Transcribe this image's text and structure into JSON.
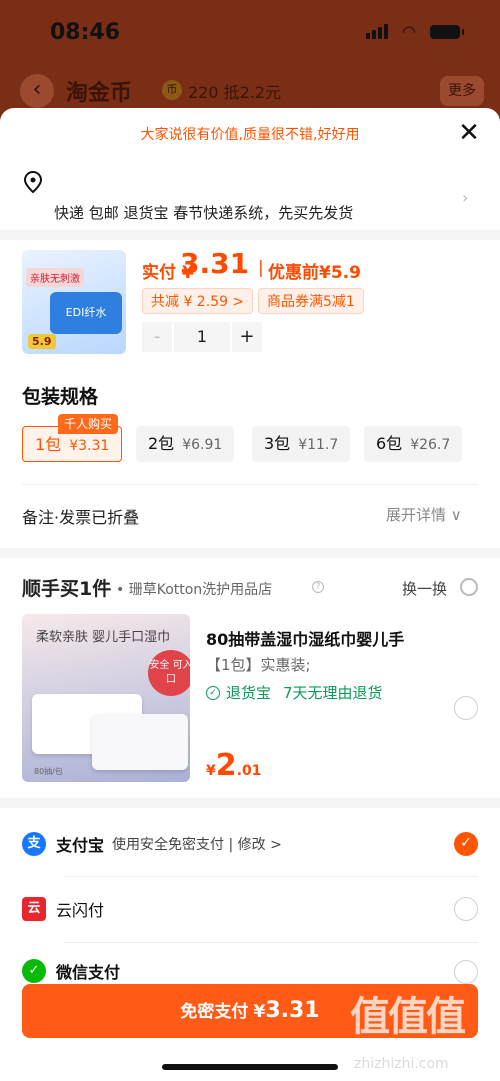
{
  "status_bar": {
    "time": "08:46"
  },
  "background_header": {
    "title": "淘金币",
    "coin_icon_char": "币",
    "coin_count": "220",
    "coin_deduct": "抵2.2元",
    "more_label": "更多"
  },
  "sheet": {
    "slogan": "大家说很有价值,质量很不错,好好用",
    "close_label": "✕",
    "address": {
      "line": "快递 包邮 退货宝 春节快递系统，先买先发货"
    },
    "product": {
      "pay_label": "实付",
      "currency": "¥",
      "pay_price": "3.31",
      "orig_sep": "|",
      "orig_label": "优惠前",
      "orig_price": "¥5.9",
      "discount_chip": "共减 ¥ 2.59 >",
      "coupon_chip": "商品券满5减1",
      "qty_minus": "-",
      "qty": "1",
      "qty_plus": "+",
      "img_tag": "亲肤无刺激",
      "img_brand": "EDI纤水",
      "img_price": "5.9"
    },
    "spec": {
      "title": "包装规格",
      "badge": "千人购买",
      "options": [
        {
          "label": "1包",
          "price": "¥3.31",
          "selected": true
        },
        {
          "label": "2包",
          "price": "¥6.91",
          "selected": false
        },
        {
          "label": "3包",
          "price": "¥11.7",
          "selected": false
        },
        {
          "label": "6包",
          "price": "¥26.7",
          "selected": false
        }
      ]
    },
    "note": {
      "left": "备注·发票已折叠",
      "right": "展开详情 ∨"
    },
    "bundle": {
      "brand": "顺手买1件",
      "shop": "• 珊草Kotton洗护用品店",
      "info_icon": "?",
      "swap_label": "换一换",
      "img_text": "柔软亲肤 婴儿手口湿巾",
      "img_safe": "安全\n可入口",
      "img_count": "80抽/包",
      "title": "80抽带盖湿巾湿纸巾婴儿手",
      "spec": "【1包】实惠装;",
      "return_label": "退货宝",
      "return_text": "7天无理由退货",
      "currency": "¥",
      "price_int": "2",
      "price_dec": ".01"
    },
    "payment_methods": [
      {
        "name": "支付宝",
        "sub": "使用安全免密支付 | 修改 >",
        "icon": "支",
        "color": "#1677ff",
        "selected": true
      },
      {
        "name": "云闪付",
        "sub": "",
        "icon": "云",
        "color": "#e8262d",
        "selected": false
      },
      {
        "name": "微信支付",
        "sub": "",
        "icon": "✓",
        "color": "#09bb07",
        "selected": false
      }
    ],
    "pay_button": {
      "label": "免密支付",
      "currency": "¥",
      "amount": "3.31"
    },
    "watermark": {
      "big": "值值值",
      "small": "zhizhizhi.com"
    }
  },
  "colors": {
    "accent": "#ff5500",
    "green": "#0a9b56"
  }
}
